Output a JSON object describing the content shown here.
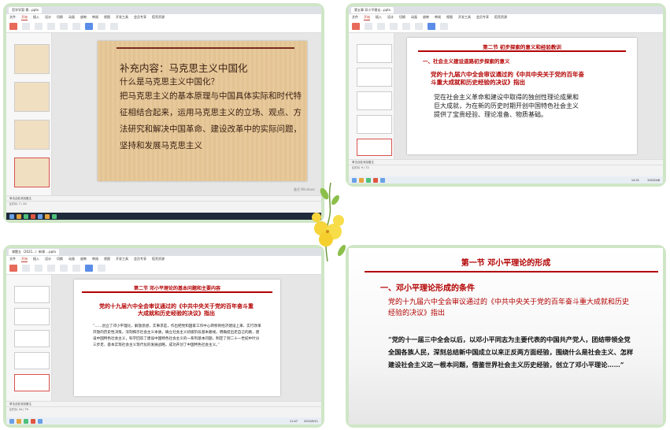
{
  "panel1": {
    "tab_title": "哲学学案-第...pptx",
    "menu": [
      "文件",
      "开始",
      "插入",
      "设计",
      "切换",
      "动画",
      "放映",
      "审阅",
      "视图",
      "开发工具",
      "会员专享",
      "稻壳资源"
    ],
    "active_menu": "开始",
    "slide": {
      "title": "补充内容：马克思主义中国化",
      "question": "什么是马克思主义中国化？",
      "body": "把马克思主义的基本原理与中国具体实际和时代特征相结合起来，运用马克思主义的立场、观点、方法研究和解决中国革命、建设改革中的实际问题，坚持和发展马克思主义"
    },
    "status": "幻灯片 7 / 20",
    "notes": "单击此处添加备注",
    "watermark": "激活 Windows"
  },
  "panel2": {
    "tab_title": "第五章 邓小平理论...pptx",
    "menu": [
      "文件",
      "开始",
      "插入",
      "设计",
      "切换",
      "动画",
      "放映",
      "审阅",
      "视图",
      "开发工具",
      "会员专享",
      "稻壳资源"
    ],
    "active_menu": "开始",
    "slide": {
      "header": "第二节 初步探索的意义和经验教训",
      "section": "一、社会主义建设道路初步探索的意义",
      "red_text": "党的十九届六中全会审议通过的《中共中央关于党的百年奋斗重大成就和历史经验的决议》指出",
      "body": "党在社会主义革命和建设中取得的独创性理论成果和巨大成就，为在新的历史时期开创中国特色社会主义提供了宝贵经验、理论准备、物质基础。"
    },
    "status": "幻灯片 9 / 72",
    "notes": "单击此处添加备注",
    "clock": "14:31",
    "date": "2022/9/8"
  },
  "panel3": {
    "tab_title": "课题五（2021...）新课 ...pptx",
    "menu": [
      "文件",
      "开始",
      "插入",
      "设计",
      "切换",
      "动画",
      "放映",
      "审阅",
      "视图",
      "开发工具",
      "会员专享",
      "稻壳资源"
    ],
    "active_menu": "开始",
    "slide": {
      "header": "第二节 邓小平理论的基本问题和主要内容",
      "red_text": "党的十九届六中全会审议通过的《中共中央关于党的百年奋斗重大成就和历史经验的决议》指出",
      "body": "“……创立了邓小平理论，解放思想，实事求是，作出把党和国家工作中心转移到经济建设上来、实行改革开放的历史性决策，深刻揭示社会主义本质，确立社会主义初级阶段基本路线，明确提出走自己的路，建设中国特色社会主义，科学回答了建设中国特色社会主义的一系列基本问题，制定了到二十一世纪中叶分三步走、基本实现社会主义现代化的发展战略，成功开创了中国特色社会主义。”"
    },
    "status": "幻灯片 44 / 79",
    "notes": "单击此处添加备注",
    "clock": "11:47",
    "date": "2022/9/11"
  },
  "panel4": {
    "slide": {
      "header": "第一节 邓小平理论的形成",
      "section": "一、邓小平理论形成的条件",
      "intro": "党的十九届六中全会审议通过的《中共中央关于党的百年奋斗重大成就和历史经验的决议》指出",
      "quote": "“党的十一届三中全会以后，以邓小平同志为主要代表的中国共产党人，团结带领全党全国各族人民，深刻总结新中国成立以来正反两方面经验，围绕什么是社会主义、怎样建设社会主义这一根本问题，借鉴世界社会主义历史经验，创立了邓小平理论……”"
    }
  },
  "colors": {
    "accent_red": "#b30000",
    "frame_green": "#cfe6c6",
    "parchment": "#e7c99b"
  }
}
